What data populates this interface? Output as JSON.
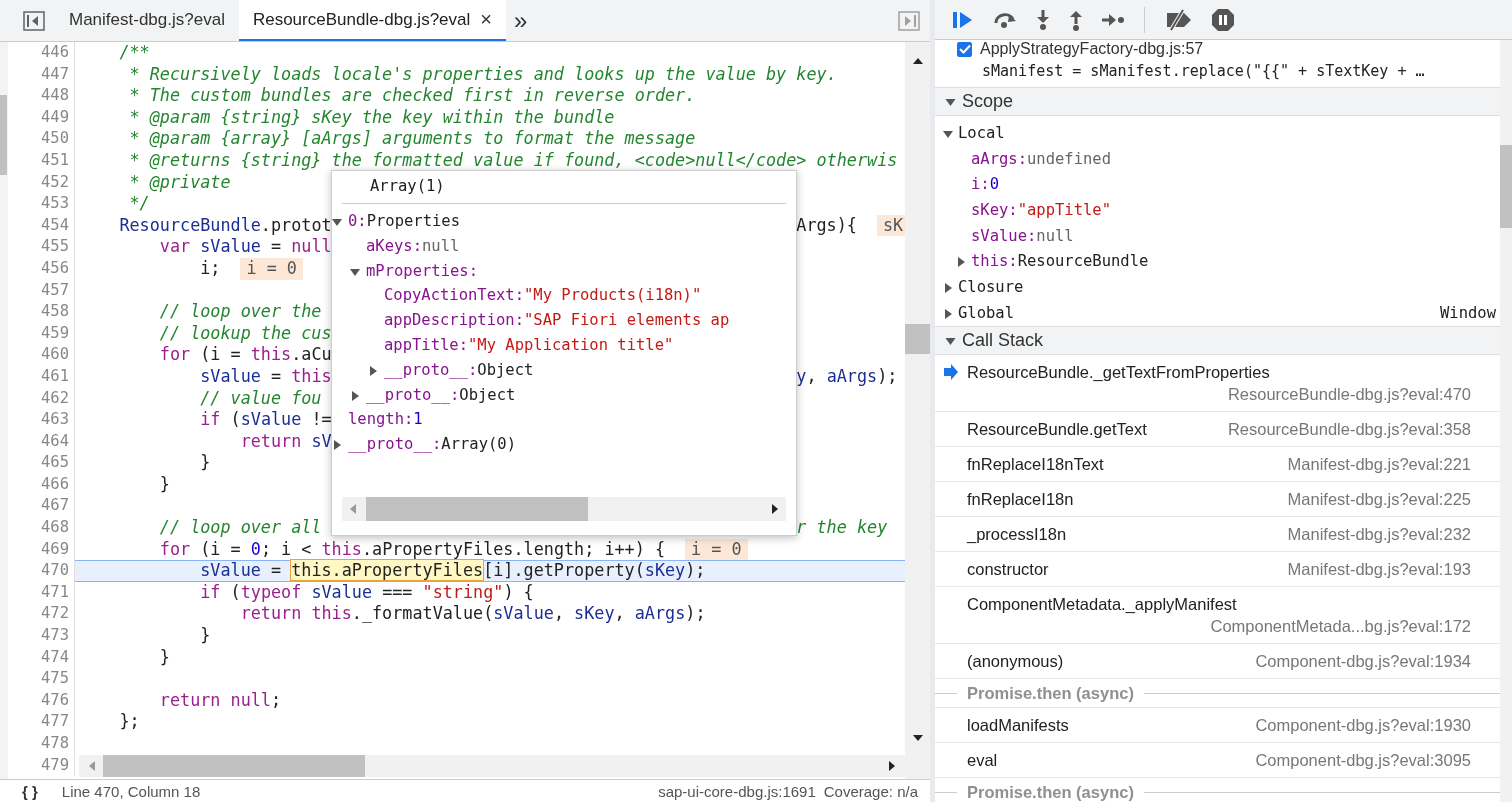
{
  "tabs": [
    {
      "label": "Manifest-dbg.js?eval",
      "selected": false
    },
    {
      "label": "ResourceBundle-dbg.js?eval",
      "selected": true,
      "close": "×"
    }
  ],
  "tab_more": "»",
  "editor": {
    "lines": [
      {
        "number": "446",
        "paused": false,
        "tokens": [
          {
            "kind": "comment",
            "text": "    /**"
          }
        ]
      },
      {
        "number": "447",
        "paused": false,
        "tokens": [
          {
            "kind": "comment",
            "text": "     * Recursively loads locale's properties and looks up the value by key."
          }
        ]
      },
      {
        "number": "448",
        "paused": false,
        "tokens": [
          {
            "kind": "comment",
            "text": "     * The custom bundles are checked first in reverse order."
          }
        ]
      },
      {
        "number": "449",
        "paused": false,
        "tokens": [
          {
            "kind": "comment",
            "text": "     * @param {string} sKey the key within the bundle"
          }
        ]
      },
      {
        "number": "450",
        "paused": false,
        "tokens": [
          {
            "kind": "comment",
            "text": "     * @param {array} [aArgs] arguments to format the message"
          }
        ]
      },
      {
        "number": "451",
        "paused": false,
        "tokens": [
          {
            "kind": "comment",
            "text": "     * @returns {string} the formatted value if found, <code>null</code> otherwis"
          }
        ]
      },
      {
        "number": "452",
        "paused": false,
        "tokens": [
          {
            "kind": "comment",
            "text": "     * @private"
          }
        ]
      },
      {
        "number": "453",
        "paused": false,
        "tokens": [
          {
            "kind": "comment",
            "text": "     */"
          }
        ]
      },
      {
        "number": "454",
        "paused": false,
        "tokens": [
          {
            "kind": "variable",
            "text": "    ResourceBundle"
          },
          {
            "kind": "plain",
            "text": ".protot"
          }
        ],
        "after": [
          {
            "kind": "plain",
            "text": "Args){"
          }
        ],
        "inline": "sK"
      },
      {
        "number": "455",
        "paused": false,
        "tokens": [
          {
            "kind": "keyword",
            "text": "        var"
          },
          {
            "kind": "variable",
            "text": " sValue"
          },
          {
            "kind": "plain",
            "text": " = "
          },
          {
            "kind": "keyword",
            "text": "null"
          }
        ]
      },
      {
        "number": "456",
        "paused": false,
        "tokens": [
          {
            "kind": "plain",
            "text": "            i;"
          }
        ],
        "inline": "i = 0"
      },
      {
        "number": "457",
        "paused": false
      },
      {
        "number": "458",
        "paused": false,
        "tokens": [
          {
            "kind": "comment",
            "text": "        // loop over the"
          }
        ]
      },
      {
        "number": "459",
        "paused": false,
        "tokens": [
          {
            "kind": "comment",
            "text": "        // lookup the cus"
          }
        ]
      },
      {
        "number": "460",
        "paused": false,
        "tokens": [
          {
            "kind": "keyword",
            "text": "        for"
          },
          {
            "kind": "plain",
            "text": " (i = "
          },
          {
            "kind": "keyword",
            "text": "this"
          },
          {
            "kind": "plain",
            "text": ".aCu"
          }
        ]
      },
      {
        "number": "461",
        "paused": false,
        "tokens": [
          {
            "kind": "variable",
            "text": "            sValue"
          },
          {
            "kind": "plain",
            "text": " = "
          },
          {
            "kind": "keyword",
            "text": "this"
          }
        ],
        "after": [
          {
            "kind": "variable",
            "text": "y"
          },
          {
            "kind": "plain",
            "text": ", "
          },
          {
            "kind": "variable",
            "text": "aArgs"
          },
          {
            "kind": "plain",
            "text": ");"
          }
        ]
      },
      {
        "number": "462",
        "paused": false,
        "tokens": [
          {
            "kind": "comment",
            "text": "            // value fou"
          }
        ]
      },
      {
        "number": "463",
        "paused": false,
        "tokens": [
          {
            "kind": "keyword",
            "text": "            if"
          },
          {
            "kind": "plain",
            "text": " ("
          },
          {
            "kind": "variable",
            "text": "sValue"
          },
          {
            "kind": "plain",
            "text": " !="
          }
        ]
      },
      {
        "number": "464",
        "paused": false,
        "tokens": [
          {
            "kind": "keyword",
            "text": "                return"
          },
          {
            "kind": "variable",
            "text": " sV"
          }
        ]
      },
      {
        "number": "465",
        "paused": false,
        "tokens": [
          {
            "kind": "plain",
            "text": "            }"
          }
        ]
      },
      {
        "number": "466",
        "paused": false,
        "tokens": [
          {
            "kind": "plain",
            "text": "        }"
          }
        ]
      },
      {
        "number": "467",
        "paused": false
      },
      {
        "number": "468",
        "paused": false,
        "tokens": [
          {
            "kind": "comment",
            "text": "        // loop over all"
          }
        ],
        "after": [
          {
            "kind": "comment",
            "text": "r the key"
          }
        ]
      },
      {
        "number": "469",
        "paused": false,
        "tokens": [
          {
            "kind": "keyword",
            "text": "        for"
          },
          {
            "kind": "plain",
            "text": " (i = "
          },
          {
            "kind": "number",
            "text": "0"
          },
          {
            "kind": "plain",
            "text": "; i < "
          },
          {
            "kind": "keyword",
            "text": "this"
          },
          {
            "kind": "plain",
            "text": ".aPropertyFiles.length; i++) {"
          }
        ],
        "inline": "i = 0"
      },
      {
        "number": "470",
        "paused": true,
        "tokens": [
          {
            "kind": "variable",
            "text": "            sValue"
          },
          {
            "kind": "plain",
            "text": " = "
          },
          {
            "kind": "hover",
            "text": "this.aPropertyFiles"
          },
          {
            "kind": "plain",
            "text": "[i].getProperty("
          },
          {
            "kind": "variable",
            "text": "sKey"
          },
          {
            "kind": "plain",
            "text": ");"
          }
        ]
      },
      {
        "number": "471",
        "paused": false,
        "tokens": [
          {
            "kind": "keyword",
            "text": "            if"
          },
          {
            "kind": "plain",
            "text": " ("
          },
          {
            "kind": "keyword",
            "text": "typeof"
          },
          {
            "kind": "variable",
            "text": " sValue"
          },
          {
            "kind": "plain",
            "text": " === "
          },
          {
            "kind": "string",
            "text": "\"string\""
          },
          {
            "kind": "plain",
            "text": ") {"
          }
        ]
      },
      {
        "number": "472",
        "paused": false,
        "tokens": [
          {
            "kind": "keyword",
            "text": "                return"
          },
          {
            "kind": "keyword",
            "text": " this"
          },
          {
            "kind": "plain",
            "text": "._formatValue("
          },
          {
            "kind": "variable",
            "text": "sValue"
          },
          {
            "kind": "plain",
            "text": ", "
          },
          {
            "kind": "variable",
            "text": "sKey"
          },
          {
            "kind": "plain",
            "text": ", "
          },
          {
            "kind": "variable",
            "text": "aArgs"
          },
          {
            "kind": "plain",
            "text": ");"
          }
        ]
      },
      {
        "number": "473",
        "paused": false,
        "tokens": [
          {
            "kind": "plain",
            "text": "            }"
          }
        ]
      },
      {
        "number": "474",
        "paused": false,
        "tokens": [
          {
            "kind": "plain",
            "text": "        }"
          }
        ]
      },
      {
        "number": "475",
        "paused": false
      },
      {
        "number": "476",
        "paused": false,
        "tokens": [
          {
            "kind": "keyword",
            "text": "        return"
          },
          {
            "kind": "keyword",
            "text": " null"
          },
          {
            "kind": "plain",
            "text": ";"
          }
        ]
      },
      {
        "number": "477",
        "paused": false,
        "tokens": [
          {
            "kind": "plain",
            "text": "    };"
          }
        ]
      },
      {
        "number": "478",
        "paused": false
      },
      {
        "number": "479",
        "paused": false
      }
    ]
  },
  "popover": {
    "title": "Array(1)",
    "tree": [
      {
        "kind": "node",
        "expanded": true,
        "key": "0:",
        "value": "Properties",
        "color": "#222222",
        "children": [
          {
            "kind": "leaf",
            "key": "aKeys:",
            "value": "null",
            "color": "#666666"
          },
          {
            "kind": "node",
            "expanded": true,
            "key": "mProperties:",
            "children": [
              {
                "kind": "leaf",
                "key": "CopyActionText:",
                "value": "\"My Products(i18n)\"",
                "color": "#c41a16"
              },
              {
                "kind": "leaf",
                "key": "appDescription:",
                "value": "\"SAP Fiori elements ap",
                "color": "#c41a16"
              },
              {
                "kind": "leaf",
                "key": "appTitle:",
                "value": "\"My Application title\"",
                "color": "#c41a16"
              },
              {
                "kind": "node",
                "expanded": false,
                "key": "__proto__:",
                "value": "Object",
                "color": "#222222"
              }
            ]
          },
          {
            "kind": "node",
            "expanded": false,
            "key": "__proto__:",
            "value": "Object",
            "color": "#222222"
          }
        ]
      },
      {
        "kind": "leaf",
        "key": "length:",
        "value": "1",
        "color": "#1c00cf"
      },
      {
        "kind": "node",
        "expanded": false,
        "key": "__proto__:",
        "value": "Array(0)",
        "color": "#222222"
      }
    ]
  },
  "status_bar": {
    "pretty_print": "{ }",
    "position": "Line 470, Column 18",
    "source": "sap-ui-core-dbg.js:1691",
    "coverage": "Coverage: n/a"
  },
  "debugger": {
    "breakpoint": {
      "checked": true,
      "label": "ApplyStrategyFactory-dbg.js:57",
      "code": "sManifest = sManifest.replace(\"{{\" + sTextKey + …"
    },
    "scope": {
      "title": "Scope",
      "expanded": true,
      "items": [
        {
          "kind": "node",
          "expanded": true,
          "key": "Local",
          "children": [
            {
              "kind": "leaf",
              "key": "aArgs:",
              "value": "undefined",
              "color": "#666666"
            },
            {
              "kind": "leaf",
              "key": "i:",
              "value": "0",
              "color": "#1c00cf"
            },
            {
              "kind": "leaf",
              "key": "sKey:",
              "value": "\"appTitle\"",
              "color": "#c41a16"
            },
            {
              "kind": "leaf",
              "key": "sValue:",
              "value": "null",
              "color": "#666666"
            },
            {
              "kind": "node",
              "expanded": false,
              "key": "this:",
              "value": "ResourceBundle",
              "color": "#222222"
            }
          ]
        },
        {
          "kind": "node",
          "expanded": false,
          "key": "Closure"
        },
        {
          "kind": "node",
          "expanded": false,
          "key": "Global",
          "aside": "Window"
        }
      ]
    },
    "call_stack": {
      "title": "Call Stack",
      "expanded": true,
      "frames": [
        {
          "kind": "frame",
          "selected": true,
          "name": "ResourceBundle._getTextFromProperties",
          "location": "ResourceBundle-dbg.js?eval:470"
        },
        {
          "kind": "frame",
          "selected": false,
          "name": "ResourceBundle.getText",
          "location": "ResourceBundle-dbg.js?eval:358"
        },
        {
          "kind": "frame",
          "selected": false,
          "name": "fnReplaceI18nText",
          "location": "Manifest-dbg.js?eval:221"
        },
        {
          "kind": "frame",
          "selected": false,
          "name": "fnReplaceI18n",
          "location": "Manifest-dbg.js?eval:225"
        },
        {
          "kind": "frame",
          "selected": false,
          "name": "_processI18n",
          "location": "Manifest-dbg.js?eval:232"
        },
        {
          "kind": "frame",
          "selected": false,
          "name": "constructor",
          "location": "Manifest-dbg.js?eval:193"
        },
        {
          "kind": "frame",
          "selected": false,
          "name": "ComponentMetadata._applyManifest",
          "location": "ComponentMetada...bg.js?eval:172"
        },
        {
          "kind": "frame",
          "selected": false,
          "name": "(anonymous)",
          "location": "Component-dbg.js?eval:1934"
        },
        {
          "kind": "async",
          "name": "Promise.then (async)"
        },
        {
          "kind": "frame",
          "selected": false,
          "name": "loadManifests",
          "location": "Component-dbg.js?eval:1930"
        },
        {
          "kind": "frame",
          "selected": false,
          "name": "eval",
          "location": "Component-dbg.js?eval:3095"
        },
        {
          "kind": "async",
          "name": "Promise.then (async)"
        }
      ]
    }
  }
}
